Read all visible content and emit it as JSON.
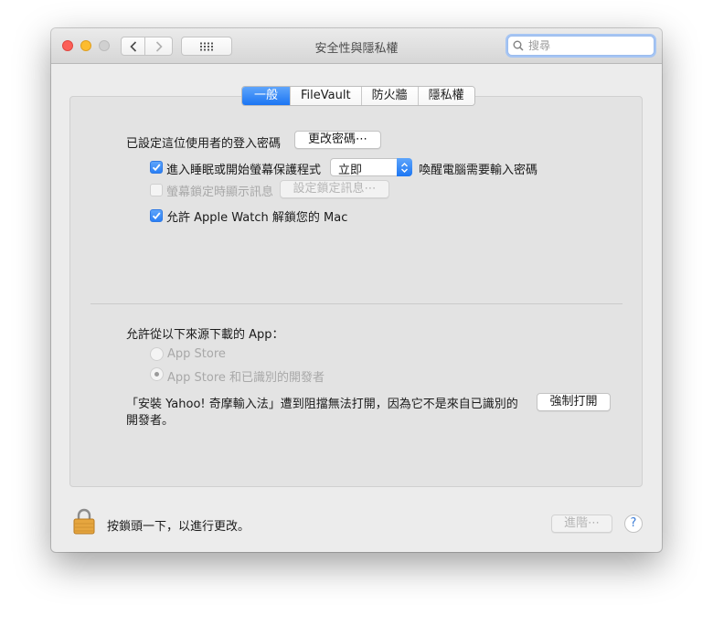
{
  "window": {
    "title": "安全性與隱私權",
    "search_placeholder": "搜尋"
  },
  "tabs": [
    {
      "label": "一般",
      "active": true
    },
    {
      "label": "FileVault",
      "active": false
    },
    {
      "label": "防火牆",
      "active": false
    },
    {
      "label": "隱私權",
      "active": false
    }
  ],
  "general": {
    "password_label": "已設定這位使用者的登入密碼",
    "change_password_button": "更改密碼⋯",
    "require_password": {
      "checked": true,
      "label": "進入睡眠或開始螢幕保護程式",
      "delay_value": "立即",
      "suffix": "喚醒電腦需要輸入密碼"
    },
    "lock_message": {
      "checked": false,
      "label": "螢幕鎖定時顯示訊息",
      "button": "設定鎖定訊息⋯"
    },
    "apple_watch": {
      "checked": true,
      "label": "允許 Apple Watch 解鎖您的 Mac"
    }
  },
  "downloads": {
    "heading": "允許從以下來源下載的 App：",
    "options": [
      {
        "label": "App Store",
        "selected": false
      },
      {
        "label": "App Store 和已識別的開發者",
        "selected": true
      }
    ],
    "blocked_line1": "「安裝 Yahoo! 奇摩輸入法」遭到阻擋無法打開，因為它不是來自已識別的",
    "blocked_line2": "開發者。",
    "open_anyway_button": "強制打開"
  },
  "footer": {
    "lock_text": "按鎖頭一下，以進行更改。",
    "advanced_button": "進階⋯",
    "help": "?"
  },
  "colors": {
    "accent": "#1b75f3",
    "close": "#fc5f57",
    "minimize": "#fdbc2e",
    "lock": "#e6a63f"
  }
}
